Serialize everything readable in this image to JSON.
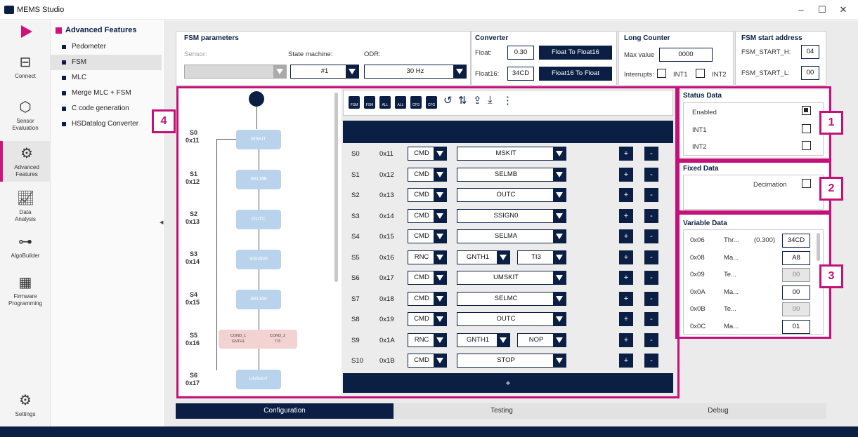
{
  "window": {
    "title": "MEMS Studio",
    "minimize": "–",
    "maximize": "☐",
    "close": "✕"
  },
  "rail": {
    "items": [
      {
        "label": "Connect"
      },
      {
        "label": "Sensor\nEvaluation"
      },
      {
        "label": "Advanced\nFeatures"
      },
      {
        "label": "Data\nAnalysis"
      },
      {
        "label": "AlgoBuilder"
      },
      {
        "label": "Firmware\nProgramming"
      },
      {
        "label": "Settings"
      }
    ]
  },
  "features": {
    "heading": "Advanced Features",
    "items": [
      "Pedometer",
      "FSM",
      "MLC",
      "Merge MLC + FSM",
      "C code generation",
      "HSDatalog Converter"
    ],
    "selected": "FSM"
  },
  "fsm_params": {
    "title": "FSM parameters",
    "sensor_label": "Sensor:",
    "sensor_value": "",
    "state_machine_label": "State machine:",
    "state_machine_value": "#1",
    "odr_label": "ODR:",
    "odr_value": "30 Hz"
  },
  "converter": {
    "title": "Converter",
    "float_label": "Float:",
    "float_value": "0.30",
    "to_float16_btn": "Float To Float16",
    "float16_label": "Float16:",
    "float16_value": "34CD",
    "to_float_btn": "Float16 To Float"
  },
  "long_counter": {
    "title": "Long Counter",
    "max_label": "Max value",
    "max_value": "0000",
    "interrupts_label": "Interrupts:",
    "int1": "INT1",
    "int2": "INT2"
  },
  "start_address": {
    "title": "FSM start address",
    "h_label": "FSM_START_H:",
    "h_value": "04",
    "l_label": "FSM_START_L:",
    "l_value": "00"
  },
  "toolbar": {
    "icons": [
      "FSM",
      "FSM",
      "ALL",
      "ALL",
      "CFG",
      "CFG"
    ]
  },
  "states": [
    {
      "s": "S0",
      "addr": "0x11",
      "type": "CMD",
      "cmd": "MSKIT"
    },
    {
      "s": "S1",
      "addr": "0x12",
      "type": "CMD",
      "cmd": "SELMB"
    },
    {
      "s": "S2",
      "addr": "0x13",
      "type": "CMD",
      "cmd": "OUTC"
    },
    {
      "s": "S3",
      "addr": "0x14",
      "type": "CMD",
      "cmd": "SSIGN0"
    },
    {
      "s": "S4",
      "addr": "0x15",
      "type": "CMD",
      "cmd": "SELMA"
    },
    {
      "s": "S5",
      "addr": "0x16",
      "type": "RNC",
      "cond1": "GNTH1",
      "cond2": "TI3"
    },
    {
      "s": "S6",
      "addr": "0x17",
      "type": "CMD",
      "cmd": "UMSKIT"
    },
    {
      "s": "S7",
      "addr": "0x18",
      "type": "CMD",
      "cmd": "SELMC"
    },
    {
      "s": "S8",
      "addr": "0x19",
      "type": "CMD",
      "cmd": "OUTC"
    },
    {
      "s": "S9",
      "addr": "0x1A",
      "type": "RNC",
      "cond1": "GNTH1",
      "cond2": "NOP"
    },
    {
      "s": "S10",
      "addr": "0x1B",
      "type": "CMD",
      "cmd": "STOP"
    }
  ],
  "plus": "+",
  "minus": "-",
  "add_row": "+",
  "diagram": {
    "labels": [
      {
        "s": "S0",
        "a": "0x11"
      },
      {
        "s": "S1",
        "a": "0x12"
      },
      {
        "s": "S2",
        "a": "0x13"
      },
      {
        "s": "S3",
        "a": "0x14"
      },
      {
        "s": "S4",
        "a": "0x15"
      },
      {
        "s": "S5",
        "a": "0x16"
      },
      {
        "s": "S6",
        "a": "0x17"
      }
    ],
    "nodes": [
      "MSKIT",
      "SELMB",
      "OUTC",
      "SSIGN0",
      "SELMA",
      "UMSKIT"
    ],
    "cond": {
      "c1": "COND_1",
      "c1v": "GNTH1",
      "c2": "COND_2",
      "c2v": "TI3"
    }
  },
  "status_data": {
    "title": "Status Data",
    "rows": [
      {
        "label": "Enabled",
        "checked": true
      },
      {
        "label": "INT1",
        "checked": false
      },
      {
        "label": "INT2",
        "checked": false
      }
    ]
  },
  "fixed_data": {
    "title": "Fixed Data",
    "decimation": "Decimation"
  },
  "variable_data": {
    "title": "Variable Data",
    "rows": [
      {
        "addr": "0x06",
        "name": "Thr...",
        "extra": "(0.300)",
        "value": "34CD",
        "enabled": true
      },
      {
        "addr": "0x08",
        "name": "Ma...",
        "extra": "",
        "value": "A8",
        "enabled": true
      },
      {
        "addr": "0x09",
        "name": "Te...",
        "extra": "",
        "value": "00",
        "enabled": false
      },
      {
        "addr": "0x0A",
        "name": "Ma...",
        "extra": "",
        "value": "00",
        "enabled": true
      },
      {
        "addr": "0x0B",
        "name": "Te...",
        "extra": "",
        "value": "00",
        "enabled": false
      },
      {
        "addr": "0x0C",
        "name": "Ma...",
        "extra": "",
        "value": "01",
        "enabled": true
      }
    ]
  },
  "callouts": [
    "1",
    "2",
    "3",
    "4"
  ],
  "tabs": [
    "Configuration",
    "Testing",
    "Debug"
  ],
  "colors": {
    "accent": "#d1127a",
    "navy": "#0b1f44",
    "node": "#b9d3ec"
  }
}
